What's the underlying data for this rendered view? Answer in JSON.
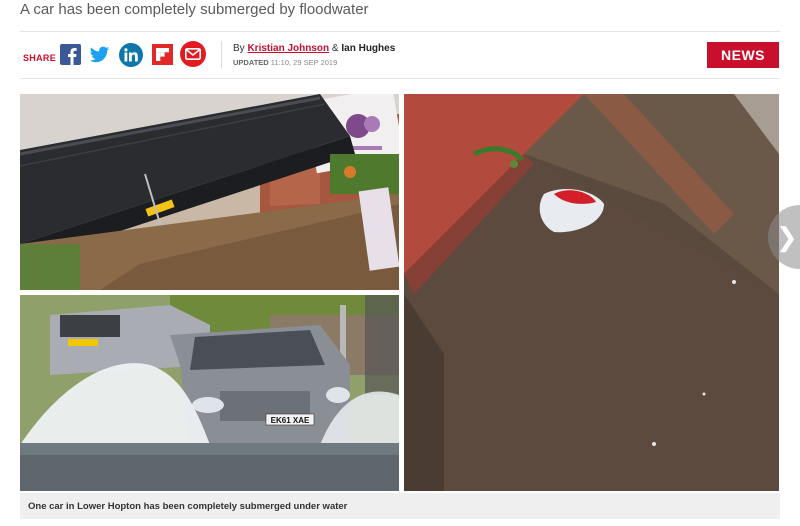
{
  "article": {
    "subtitle": "A car has been completely submerged by floodwater",
    "byline_prefix": "By",
    "author1": "Kristian Johnson",
    "byline_amp": "&",
    "author2": "Ian Hughes",
    "updated_label": "UPDATED",
    "updated_time": "11:10, 29 SEP 2019",
    "section_badge": "NEWS"
  },
  "share": {
    "label": "SHARE",
    "icons": [
      "facebook-icon",
      "twitter-icon",
      "linkedin-icon",
      "flipboard-icon",
      "email-icon"
    ]
  },
  "gallery": {
    "caption": "One car in Lower Hopton has been completely submerged under water",
    "plate_text": "EK61 XAE",
    "next_icon": "chevron-right-icon"
  },
  "colors": {
    "brand_red": "#c8102e",
    "facebook": "#3b5998",
    "twitter": "#1da1f2",
    "linkedin": "#0e76a8",
    "flipboard": "#e12828"
  }
}
